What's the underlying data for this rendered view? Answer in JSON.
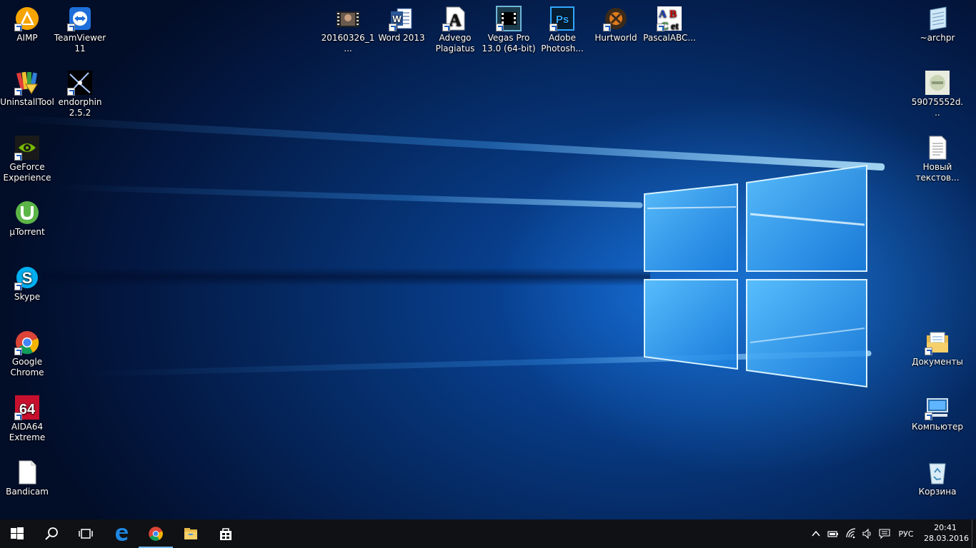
{
  "desktop_icons": [
    {
      "label": "AIMP"
    },
    {
      "label": "TeamViewer 11"
    },
    {
      "label": "20160326_1..."
    },
    {
      "label": "Word 2013"
    },
    {
      "label": "Advego Plagiatus"
    },
    {
      "label": "Vegas Pro 13.0 (64-bit)"
    },
    {
      "label": "Adobe Photosh..."
    },
    {
      "label": "Hurtworld"
    },
    {
      "label": "PascalABC..."
    },
    {
      "label": "~archpr"
    },
    {
      "label": "UninstallTool"
    },
    {
      "label": "endorphin 2.5.2"
    },
    {
      "label": "59075552d..."
    },
    {
      "label": "GeForce Experience"
    },
    {
      "label": "Новый текстов..."
    },
    {
      "label": "µTorrent"
    },
    {
      "label": "Skype"
    },
    {
      "label": "Google Chrome"
    },
    {
      "label": "Документы"
    },
    {
      "label": "AIDA64 Extreme"
    },
    {
      "label": "Компьютер"
    },
    {
      "label": "Bandicam"
    },
    {
      "label": "Корзина"
    }
  ],
  "taskbar": {
    "language": "РУС",
    "time": "20:41",
    "date": "28.03.2016"
  },
  "colors": {
    "taskbar_bg": "#0f1114",
    "accent": "#76b9ed",
    "desktop_blue": "#0a4fae"
  }
}
